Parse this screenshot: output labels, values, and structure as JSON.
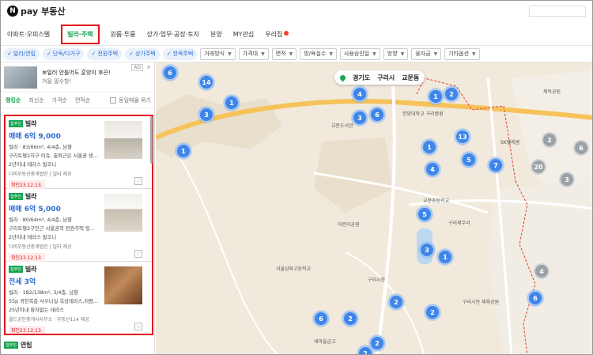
{
  "header": {
    "logo_n": "N",
    "logo_pay": "pay",
    "title": "부동산"
  },
  "nav": [
    {
      "label": "아파트·오피스텔",
      "active": false
    },
    {
      "label": "빌라·주택",
      "active": true
    },
    {
      "label": "원룸·투룸",
      "active": false
    },
    {
      "label": "상가·업무·공장·토지",
      "active": false
    },
    {
      "label": "분양",
      "active": false
    },
    {
      "label": "MY관심",
      "active": false
    },
    {
      "label": "우리집",
      "active": false
    }
  ],
  "filters": {
    "chips": [
      "빌라/연립",
      "단독/다가구",
      "전원주택",
      "상가주택",
      "한옥주택"
    ],
    "dropdowns": [
      "거래방식",
      "가격대",
      "면적",
      "방/욕실수",
      "사용승인일",
      "방향",
      "융자금",
      "기타옵션"
    ]
  },
  "sidebar": {
    "ad": {
      "line1": "보일러 안틀어도 훈방이 후끈!",
      "line2": "겨울 필수항!",
      "tag": "AD",
      "close": "×"
    },
    "sort": {
      "options": [
        "랭킹순",
        "최신순",
        "가격순",
        "면적순"
      ],
      "same": "동일매물 묶기"
    },
    "listings": [
      {
        "badge": "집주인",
        "kind": "빌라",
        "price": "매매 6억 9,000",
        "desc": "빌라 · 83/66m², 4/4층, 남향",
        "feat1": "구리토평2지구 이슈, 출퇴근은 서울권 생...",
        "feat2": "2년이내   테라스   발코니",
        "agent": "다비부동산중개법인 | 일터 제공",
        "confirm": "확인23.12.13."
      },
      {
        "badge": "집주인",
        "kind": "빌라",
        "price": "매매 6억 5,000",
        "desc": "빌라 · 80/64m², 4/4층, 남향",
        "feat1": "구리토평2구인근 서울권의 전원주택 뒷...",
        "feat2": "2년이내   테라스   발코니",
        "agent": "다비부동산중개법인 | 일터 제공",
        "confirm": "확인23.12.13."
      },
      {
        "badge": "집주인",
        "kind": "빌라",
        "price": "전세 3억",
        "desc": "빌라 · 182/138m², 3/4층, 남향",
        "feat1": "55p 귀한복층 사우나실 옥상테라스,저렴...",
        "feat2": "25년이내   융자없는   테라스",
        "agent": "월드공인중개사사무소 · 부동산114 제공",
        "confirm": "확인23.12.13."
      }
    ],
    "next": {
      "badge": "집주인",
      "kind": "연립"
    }
  },
  "map": {
    "location": [
      "경기도",
      "구리시",
      "교문동"
    ],
    "markers": [
      {
        "n": "6"
      },
      {
        "n": "14"
      },
      {
        "n": "1"
      },
      {
        "n": "3"
      },
      {
        "n": "1"
      },
      {
        "n": "4"
      },
      {
        "n": "1"
      },
      {
        "n": "2"
      },
      {
        "n": "3"
      },
      {
        "n": "6"
      },
      {
        "n": "1"
      },
      {
        "n": "13"
      },
      {
        "n": "4"
      },
      {
        "n": "5"
      },
      {
        "n": "7"
      },
      {
        "n": "5"
      },
      {
        "n": "3"
      },
      {
        "n": "1"
      },
      {
        "n": "2"
      },
      {
        "n": "2"
      },
      {
        "n": "6"
      },
      {
        "n": "2"
      },
      {
        "n": "6"
      },
      {
        "n": "2"
      },
      {
        "n": "2"
      },
      {
        "n": "20"
      },
      {
        "n": "3"
      },
      {
        "n": "6"
      },
      {
        "n": "2"
      },
      {
        "n": "4"
      }
    ],
    "labels": [
      "한양대학교 구리병원",
      "구리시청",
      "SK텔레콤",
      "교문초등학교",
      "구리세무서",
      "서울삼육고등학교",
      "구리시민 체육공원",
      "어린이공원",
      "교문도서관",
      "제독공원",
      "새마을금고"
    ]
  },
  "colors": {
    "accent_green": "#15a650",
    "link_blue": "#2d6bd3",
    "highlight_red": "#e0141e",
    "marker_blue": "#3f86e8"
  }
}
